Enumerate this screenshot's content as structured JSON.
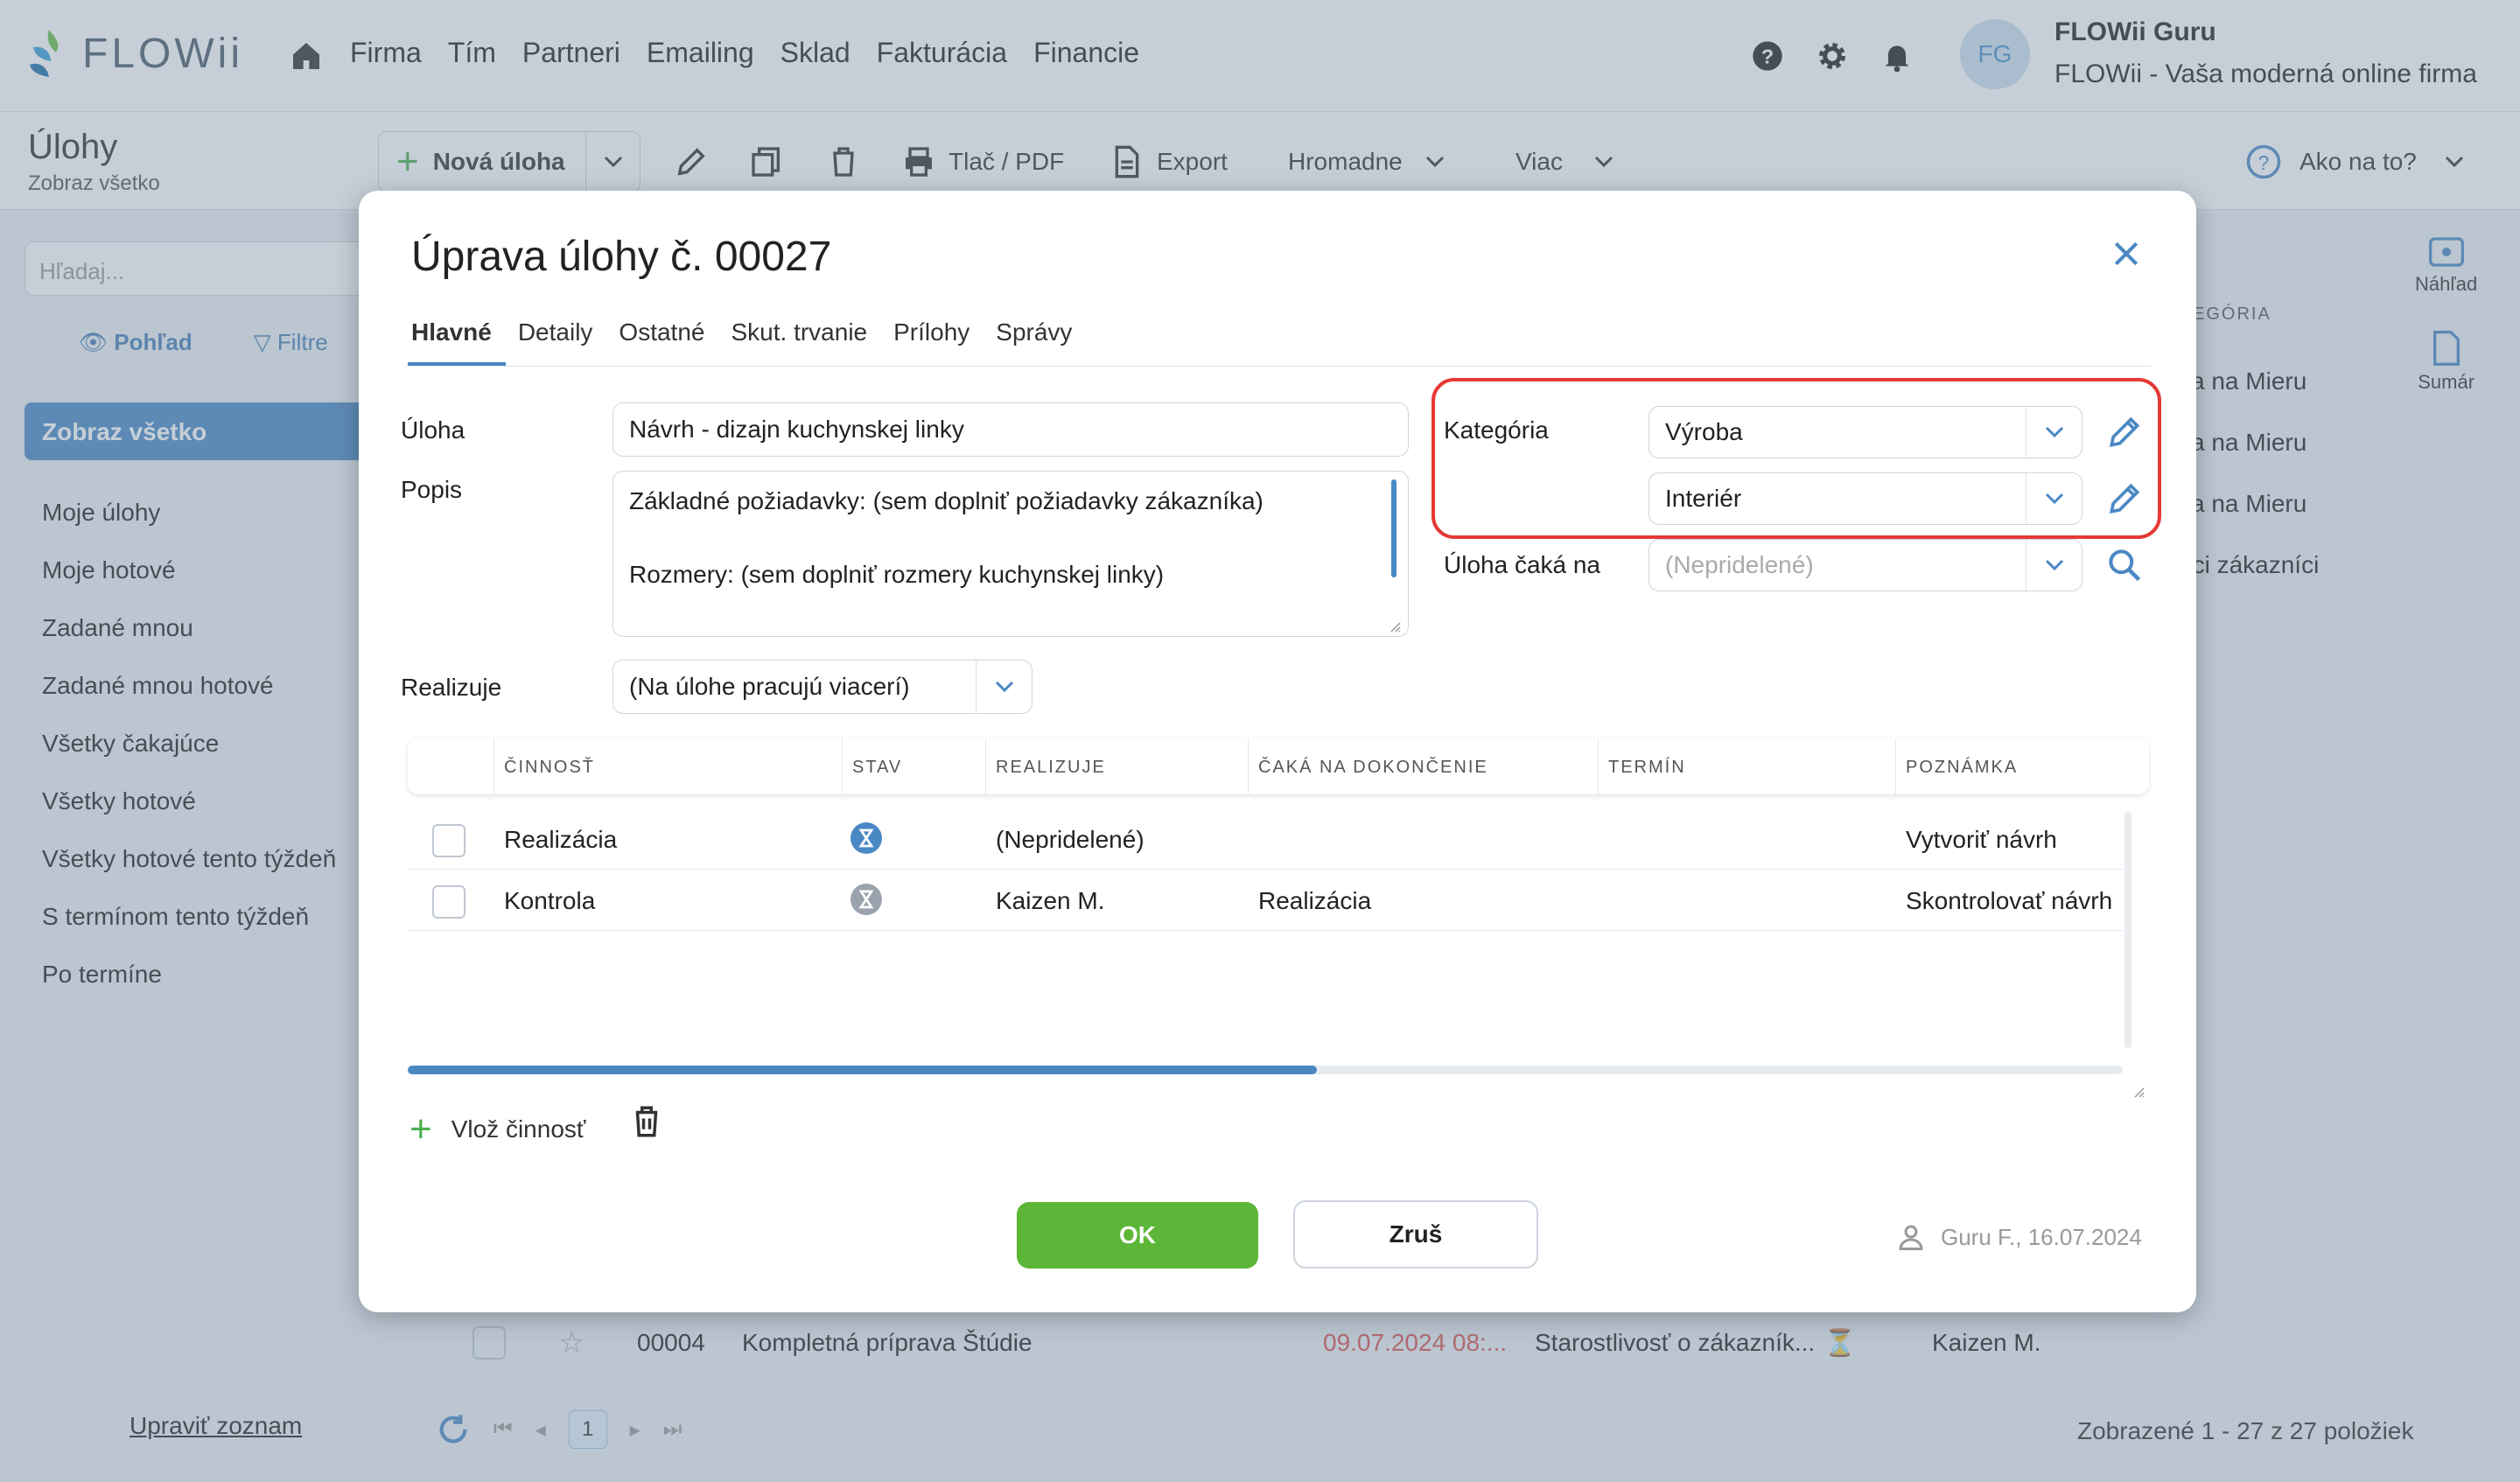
{
  "app": {
    "logo_text": "FLOWii"
  },
  "topnav": [
    "Firma",
    "Tím",
    "Partneri",
    "Emailing",
    "Sklad",
    "Fakturácia",
    "Financie"
  ],
  "user": {
    "initials": "FG",
    "name": "FLOWii Guru",
    "company": "FLOWii - Vaša moderná online firma"
  },
  "page": {
    "title": "Úlohy",
    "subtitle": "Zobraz všetko"
  },
  "toolbar": {
    "new_task": "Nová úloha",
    "print": "Tlač / PDF",
    "export": "Export",
    "bulk": "Hromadne",
    "more": "Viac",
    "help": "Ako na to?"
  },
  "sidebar": {
    "search_placeholder": "Hľadaj...",
    "view_tab": "Pohľad",
    "filter_tab": "Filtre",
    "selected": "Zobraz všetko",
    "items": [
      "Moje úlohy",
      "Moje hotové",
      "Zadané mnou",
      "Zadané mnou hotové",
      "Všetky čakajúce",
      "Všetky hotové",
      "Všetky hotové tento týždeň",
      "S termínom tento týždeň",
      "Po termíne"
    ],
    "edit_list": "Upraviť zoznam"
  },
  "right_rail": {
    "preview": "Náhľad",
    "summary": "Sumár"
  },
  "background": {
    "col_header_fragment": "EGÓRIA",
    "list": [
      "ka na Mieru",
      "ka na Mieru",
      "ka na Mieru",
      "úci zákazníci"
    ],
    "row": {
      "id": "00004",
      "name": "Kompletná príprava Štúdie",
      "date": "09.07.2024 08:...",
      "category": "Starostlivosť o zákazník...",
      "assignee": "Kaizen M."
    },
    "pager_current": "1",
    "count": "Zobrazené 1 - 27 z 27 položiek"
  },
  "modal": {
    "title": "Úprava úlohy č. 00027",
    "tabs": [
      "Hlavné",
      "Detaily",
      "Ostatné",
      "Skut. trvanie",
      "Prílohy",
      "Správy"
    ],
    "labels": {
      "task": "Úloha",
      "description": "Popis",
      "assignee": "Realizuje",
      "category": "Kategória",
      "waits_on": "Úloha čaká na"
    },
    "task_value": "Návrh - dizajn kuchynskej linky",
    "description_line1": "Základné požiadavky: (sem doplniť požiadavky zákazníka)",
    "description_line2": "Rozmery: (sem doplniť rozmery kuchynskej linky)",
    "assignee_value": "(Na úlohe pracujú viacerí)",
    "category_value": "Výroba",
    "subcategory_value": "Interiér",
    "waits_on_placeholder": "(Nepridelené)",
    "grid": {
      "headers": [
        "ČINNOSŤ",
        "STAV",
        "REALIZUJE",
        "ČAKÁ NA DOKONČENIE",
        "TERMÍN",
        "POZNÁMKA"
      ],
      "rows": [
        {
          "activity": "Realizácia",
          "status": "in-progress",
          "assignee": "(Nepridelené)",
          "waits": "",
          "due": "",
          "note": "Vytvoriť návrh"
        },
        {
          "activity": "Kontrola",
          "status": "waiting",
          "assignee": "Kaizen M.",
          "waits": "Realizácia",
          "due": "",
          "note": "Skontrolovať návrh"
        }
      ],
      "scroll_fraction": 0.53
    },
    "add_activity": "Vlož činnosť",
    "ok": "OK",
    "cancel": "Zruš",
    "audit": "Guru F., 16.07.2024"
  },
  "colors": {
    "accent": "#4a88c4",
    "ok": "#5cb637",
    "highlight": "#e53935",
    "overdue": "#d9534f"
  }
}
